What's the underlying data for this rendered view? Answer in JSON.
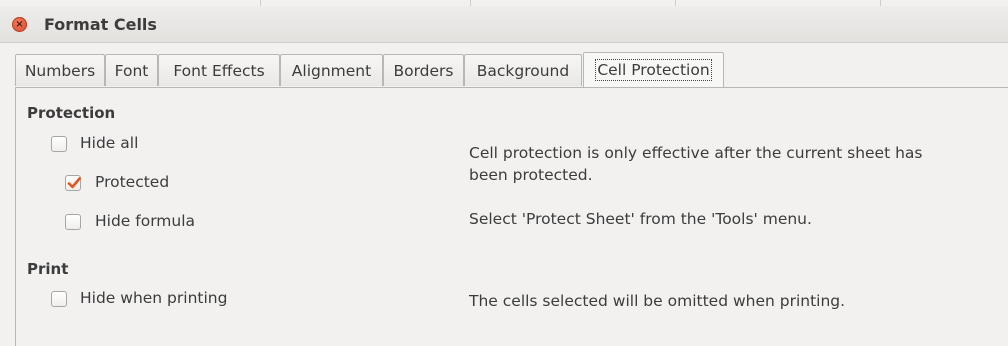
{
  "window": {
    "title": "Format Cells",
    "close_glyph": "×"
  },
  "tabs": [
    {
      "label": "Numbers",
      "active": false
    },
    {
      "label": "Font",
      "active": false
    },
    {
      "label": "Font Effects",
      "active": false
    },
    {
      "label": "Alignment",
      "active": false
    },
    {
      "label": "Borders",
      "active": false
    },
    {
      "label": "Background",
      "active": false
    },
    {
      "label": "Cell Protection",
      "active": true
    }
  ],
  "protection": {
    "title": "Protection",
    "hide_all": {
      "label": "Hide all",
      "checked": false
    },
    "protected": {
      "label": "Protected",
      "checked": true
    },
    "hide_formula": {
      "label": "Hide formula",
      "checked": false
    },
    "info_line1": "Cell protection is only effective after the current sheet has",
    "info_line2": "been protected.",
    "info_tools": "Select 'Protect Sheet' from the 'Tools' menu."
  },
  "print": {
    "title": "Print",
    "hide_when_printing": {
      "label": "Hide when printing",
      "checked": false
    },
    "info": "The cells selected will be omitted when printing."
  },
  "colors": {
    "checkmark": "#e9541e",
    "close_button": "#df5532"
  }
}
